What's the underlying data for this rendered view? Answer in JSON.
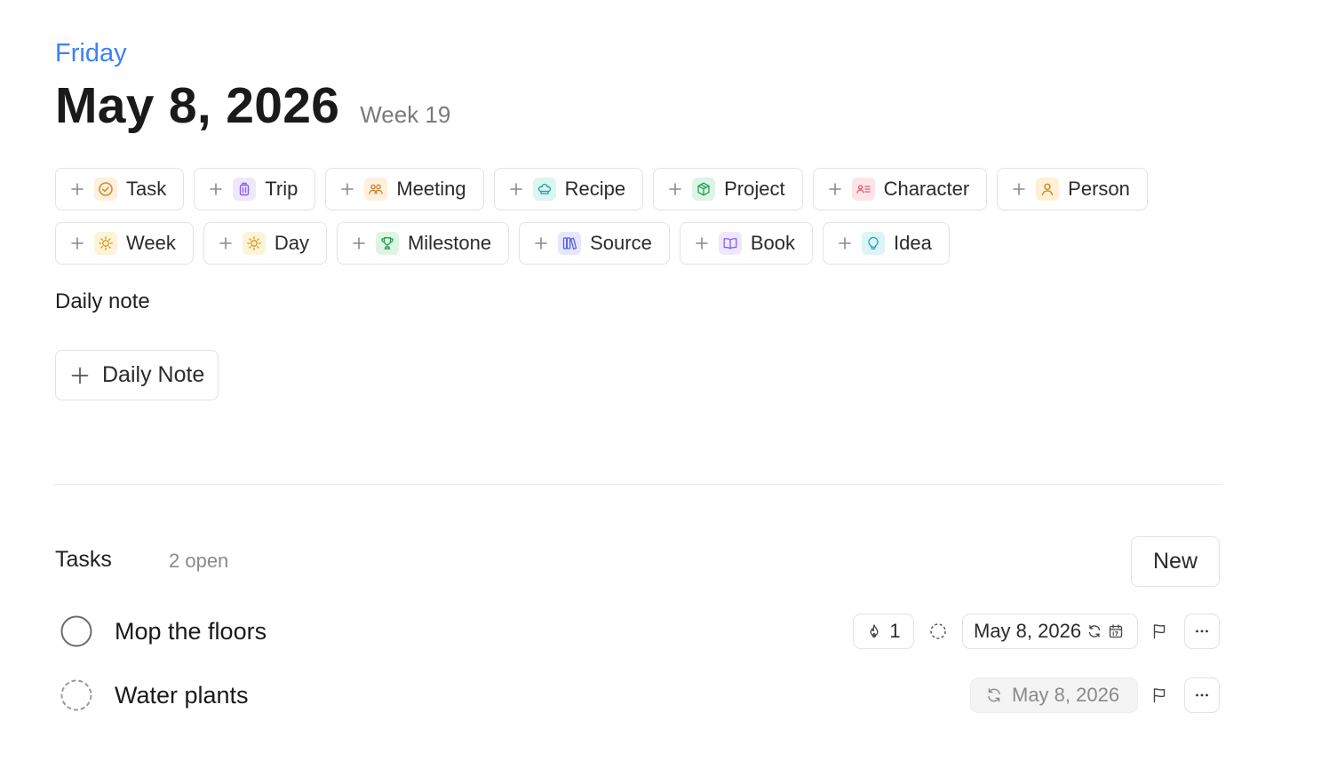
{
  "header": {
    "weekday": "Friday",
    "date": "May 8, 2026",
    "week": "Week 19"
  },
  "templates": {
    "row1": [
      {
        "label": "Task",
        "icon": "check-circle-icon"
      },
      {
        "label": "Trip",
        "icon": "luggage-icon"
      },
      {
        "label": "Meeting",
        "icon": "people-icon"
      },
      {
        "label": "Recipe",
        "icon": "chef-hat-icon"
      },
      {
        "label": "Project",
        "icon": "box-icon"
      },
      {
        "label": "Character",
        "icon": "contact-card-icon"
      },
      {
        "label": "Person",
        "icon": "person-icon"
      }
    ],
    "row2": [
      {
        "label": "Week",
        "icon": "sun-icon"
      },
      {
        "label": "Day",
        "icon": "sun-icon"
      },
      {
        "label": "Milestone",
        "icon": "trophy-icon"
      },
      {
        "label": "Source",
        "icon": "library-icon"
      },
      {
        "label": "Book",
        "icon": "open-book-icon"
      },
      {
        "label": "Idea",
        "icon": "lightbulb-icon"
      }
    ]
  },
  "daily": {
    "section_label": "Daily note",
    "button_label": "Daily Note"
  },
  "tasks": {
    "title": "Tasks",
    "count": "2 open",
    "new_label": "New",
    "items": [
      {
        "title": "Mop the floors",
        "streak": "1",
        "date": "May 8, 2026",
        "status": "open"
      },
      {
        "title": "Water plants",
        "date": "May 8, 2026",
        "status": "recurring"
      }
    ]
  },
  "colors": {
    "accent": "#3b82f6",
    "task_icon": "#e0a04a",
    "trip_icon": "#8b5cf6",
    "meeting_icon": "#d9903a",
    "recipe_icon": "#14a39a",
    "project_icon": "#1f9d5a",
    "character_icon": "#e05a6a",
    "person_icon": "#d99a2a",
    "sun_icon": "#e0a030",
    "milestone_icon": "#22a35a",
    "source_icon": "#6366f1",
    "book_icon": "#8b5cf6",
    "idea_icon": "#14b8c4"
  }
}
